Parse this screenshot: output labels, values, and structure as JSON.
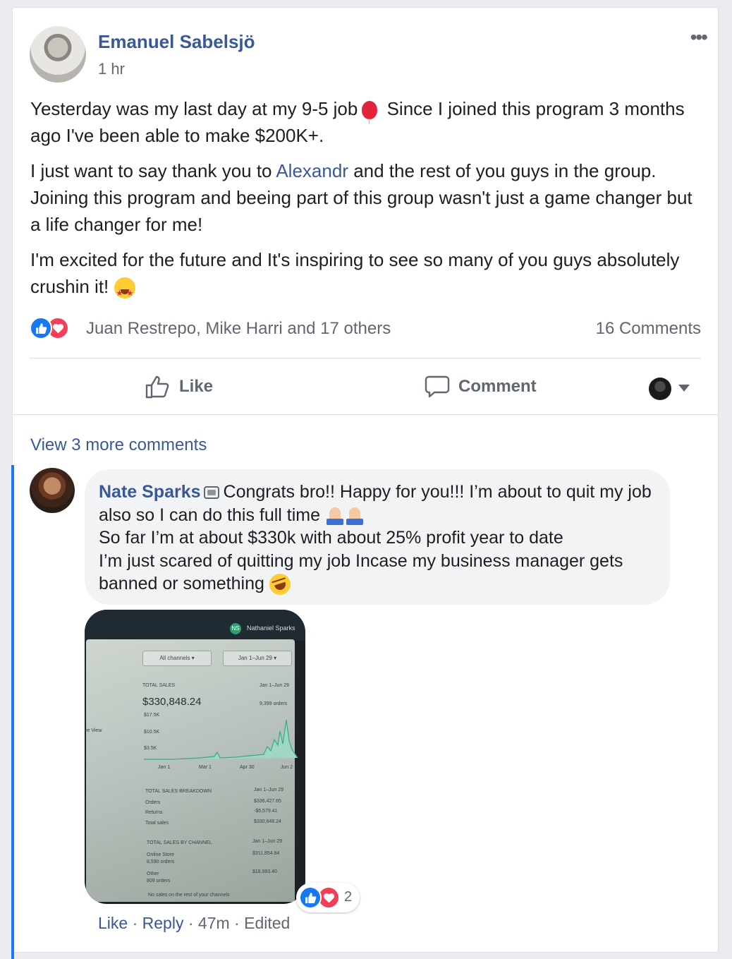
{
  "post": {
    "author": "Emanuel Sabelsjö",
    "time": "1 hr",
    "more": "•••",
    "p1_a": "Yesterday was my last day at my 9-5 job",
    "p1_b": "Since I joined this program 3 months ago I've been able to make $200K+.",
    "p2_a": "I just want to say thank you to",
    "p2_link": "Alexandr",
    "p2_b": "and the rest of you guys in the group. Joining this program and beeing part of this group wasn't just a game changer but a life changer for me!",
    "p3": "I'm excited for the future and It's inspiring to see so many of you guys absolutely crushin it!",
    "reactions_names": "Juan Restrepo, Mike Harri and 17 others",
    "comments_count": "16 Comments"
  },
  "actions": {
    "like": "Like",
    "comment": "Comment"
  },
  "comments": {
    "view_more": "View 3 more comments",
    "c1": {
      "name": "Nate Sparks",
      "line1": "Congrats bro!! Happy for you!!! I’m about to quit my job also so I can do this full time",
      "line2": "So far I’m at about $330k with about 25% profit year to date",
      "line3": "I’m just scared of quitting my job Incase my business manager gets banned or something",
      "reaction_count": "2",
      "meta_like": "Like",
      "meta_reply": "Reply",
      "meta_time": "47m",
      "meta_edited": "Edited"
    }
  },
  "photo": {
    "initials": "NS",
    "account": "Nathaniel Sparks",
    "filter_channels": "All channels ▾",
    "filter_date": "Jan 1–Jun 29 ▾",
    "total_sales_label": "TOTAL SALES",
    "total_sales_date": "Jan 1–Jun 29",
    "total_sales_value": "$330,848.24",
    "orders": "9,399 orders",
    "y_ticks": [
      "$17.5K",
      "$10.5K",
      "$3.5K"
    ],
    "x_ticks": [
      "Jan 1",
      "Mar 1",
      "Apr 30",
      "Jun 2"
    ],
    "side_label": "ve View",
    "breakdown_label": "TOTAL SALES BREAKDOWN",
    "breakdown_date": "Jan 1–Jun 29",
    "breakdown_rows": [
      {
        "label": "Orders",
        "value": "$336,427.65"
      },
      {
        "label": "Returns",
        "value": "-$5,579.41"
      },
      {
        "label": "Total sales",
        "value": "$330,848.24"
      }
    ],
    "channel_label": "TOTAL SALES BY CHANNEL",
    "channel_date": "Jan 1–Jun 29",
    "channel_rows": [
      {
        "label": "Online Store",
        "sub": "8,590 orders",
        "value": "$311,854.84"
      },
      {
        "label": "Other",
        "sub": "809 orders",
        "value": "$18,993.40"
      }
    ],
    "footer": "No sales on the rest of your channels"
  }
}
